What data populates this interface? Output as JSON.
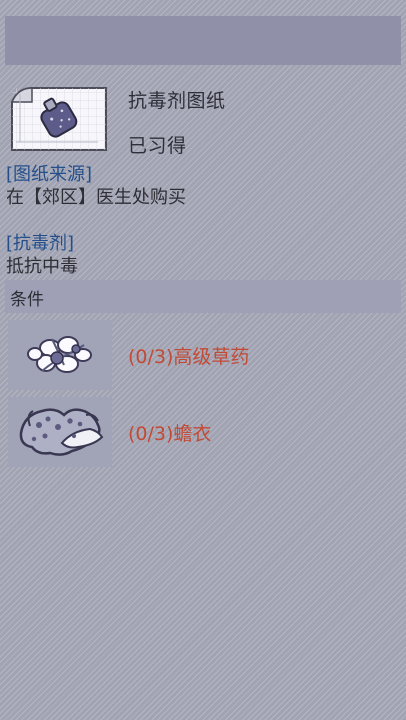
{
  "header": {
    "item_name": "抗毒剂图纸",
    "status": "已习得"
  },
  "sections": {
    "source_title": "[图纸来源]",
    "source_text": "在【郊区】医生处购买",
    "effect_title": "[抗毒剂]",
    "effect_text": "抵抗中毒"
  },
  "conditions": {
    "title": "条件",
    "items": [
      {
        "label": "(0/3)高级草药",
        "icon": "herb-icon"
      },
      {
        "label": "(0/3)蟾衣",
        "icon": "toad-skin-icon"
      }
    ]
  },
  "colors": {
    "accent_blue": "#244f8a",
    "accent_red": "#c24a35"
  }
}
